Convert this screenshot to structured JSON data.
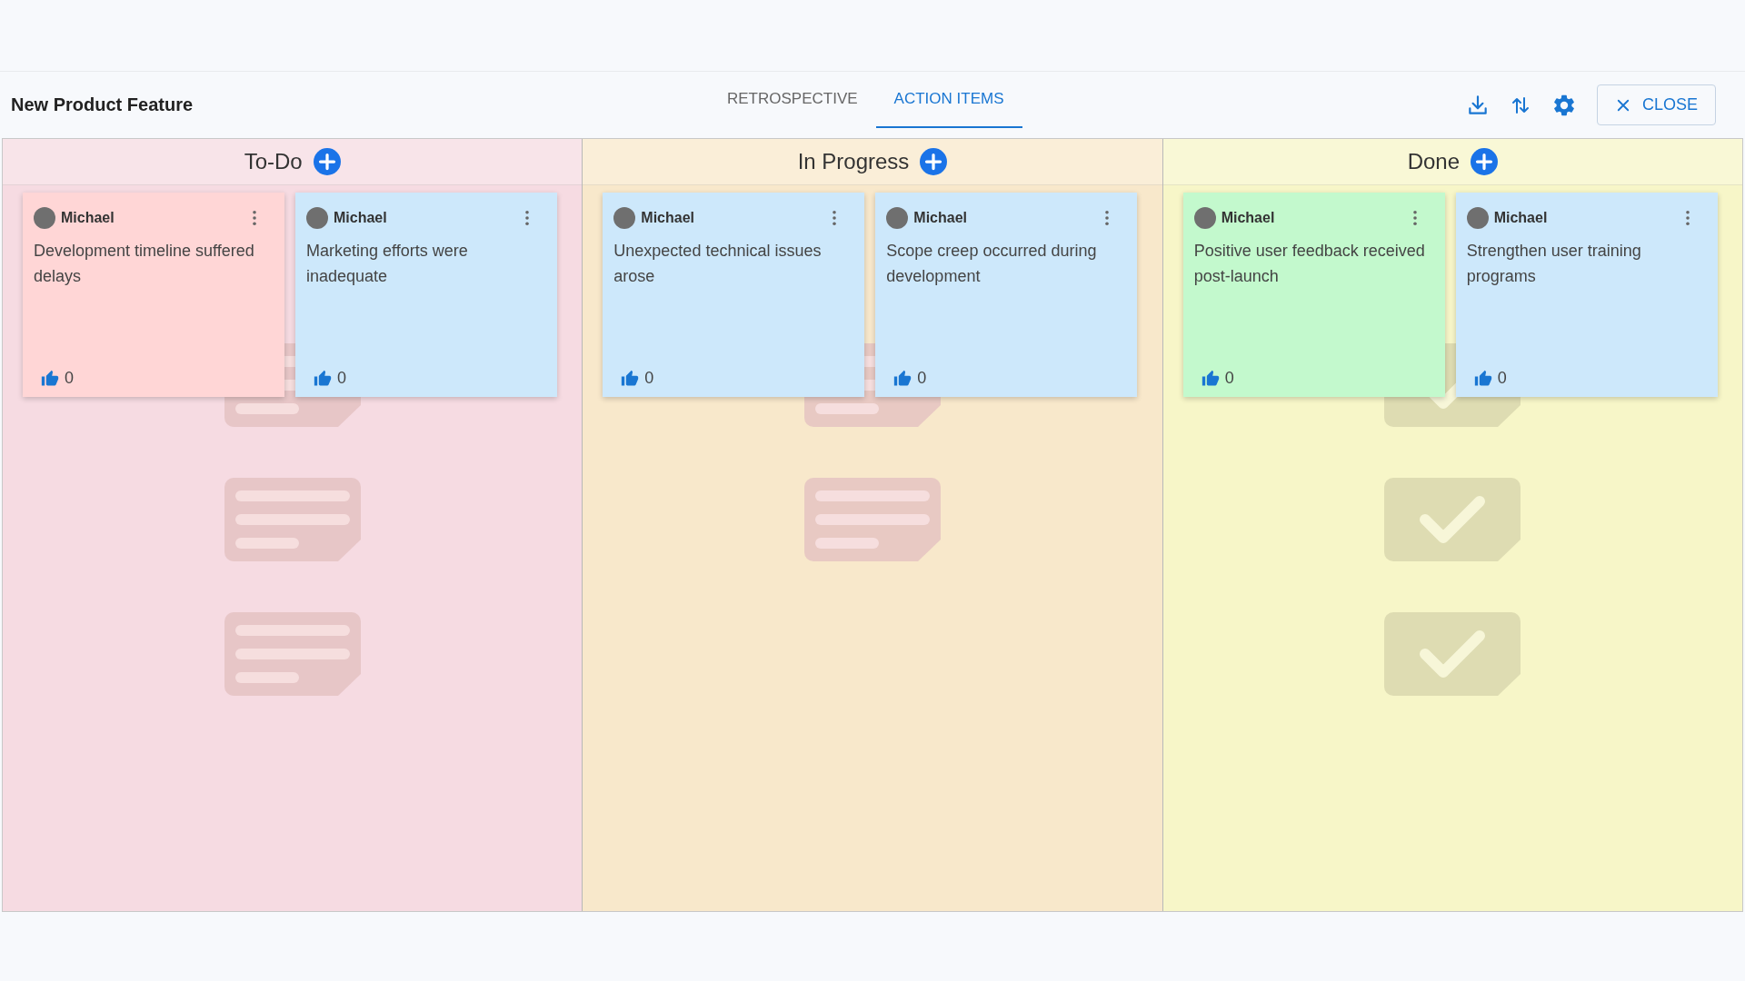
{
  "board": {
    "title": "New Product Feature"
  },
  "tabs": [
    {
      "label": "RETROSPECTIVE",
      "selected": false
    },
    {
      "label": "ACTION ITEMS",
      "selected": true
    }
  ],
  "close_button": {
    "label": "CLOSE"
  },
  "columns": [
    {
      "title": "To-Do",
      "color": "#f6dbe2",
      "backdrop": [
        {
          "kind": "note"
        },
        {
          "kind": "note"
        },
        {
          "kind": "note"
        }
      ],
      "cards": [
        {
          "author": "Michael",
          "text": "Development timeline suffered delays",
          "likes": "0",
          "color": "#ffd6d6"
        },
        {
          "author": "Michael",
          "text": "Marketing efforts were inadequate",
          "likes": "0",
          "color": "#cde8fb"
        }
      ]
    },
    {
      "title": "In Progress",
      "color": "#f8e8cb",
      "backdrop": [
        {
          "kind": "note"
        },
        {
          "kind": "note"
        }
      ],
      "cards": [
        {
          "author": "Michael",
          "text": "Unexpected technical issues arose",
          "likes": "0",
          "color": "#cde8fb"
        },
        {
          "author": "Michael",
          "text": "Scope creep occurred during development",
          "likes": "0",
          "color": "#cde8fb"
        }
      ]
    },
    {
      "title": "Done",
      "color": "#f7f6c8",
      "backdrop": [
        {
          "kind": "check"
        },
        {
          "kind": "check"
        },
        {
          "kind": "check"
        }
      ],
      "cards": [
        {
          "author": "Michael",
          "text": "Positive user feedback received post-launch",
          "likes": "0",
          "color": "#c3f9cd"
        },
        {
          "author": "Michael",
          "text": "Strengthen user training programs",
          "likes": "0",
          "color": "#cde8fb"
        }
      ]
    }
  ]
}
